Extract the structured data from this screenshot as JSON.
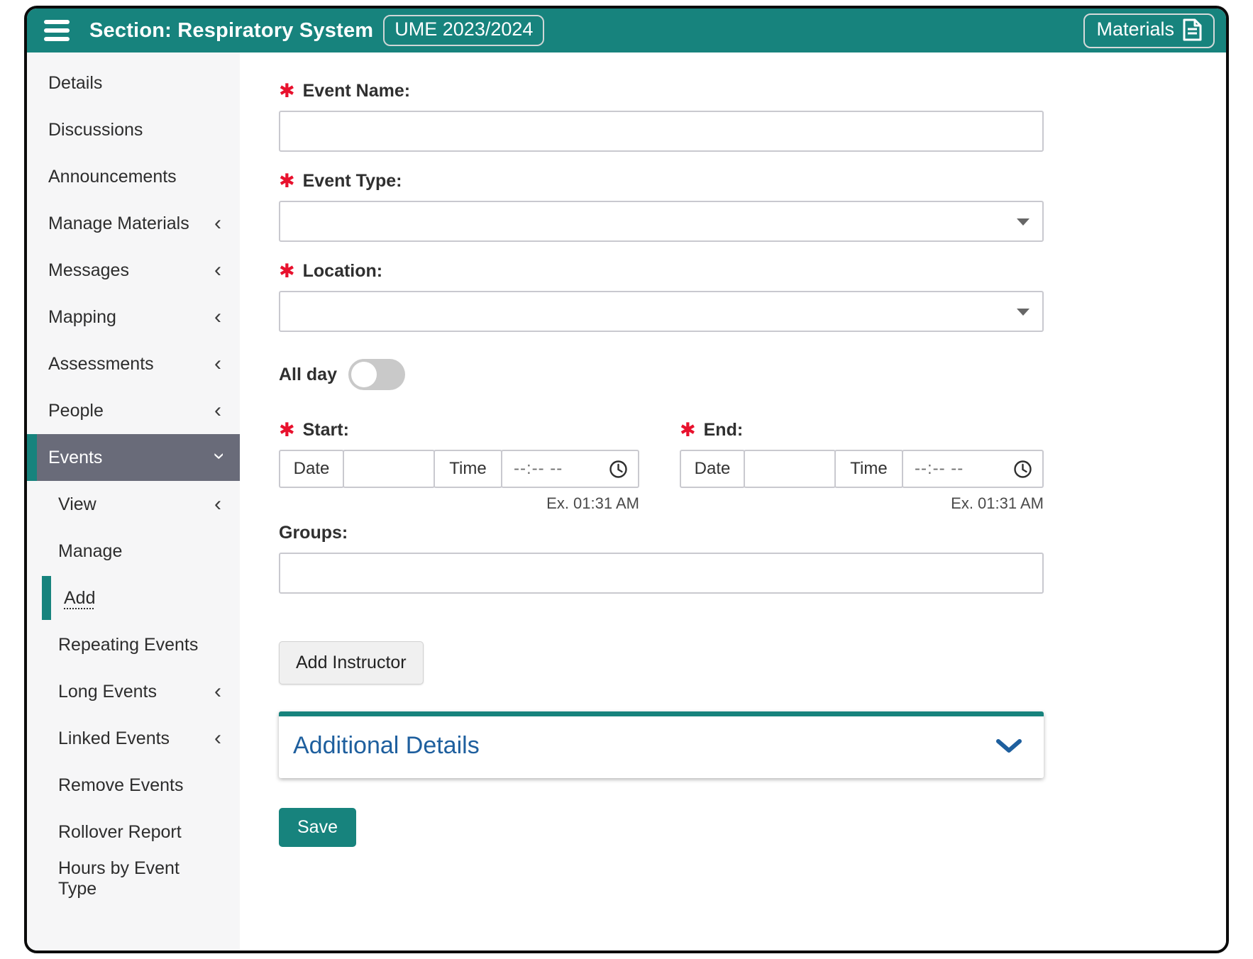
{
  "colors": {
    "teal": "#17837d",
    "selected_gray": "#696b79",
    "link_blue": "#1e5f9e",
    "required_red": "#e8112d"
  },
  "header": {
    "title": "Section: Respiratory System",
    "badge": "UME 2023/2024",
    "materials_label": "Materials"
  },
  "sidebar": {
    "items": [
      {
        "label": "Details",
        "chevron": ""
      },
      {
        "label": "Discussions",
        "chevron": ""
      },
      {
        "label": "Announcements",
        "chevron": ""
      },
      {
        "label": "Manage Materials",
        "chevron": "‹"
      },
      {
        "label": "Messages",
        "chevron": "‹"
      },
      {
        "label": "Mapping",
        "chevron": "‹"
      },
      {
        "label": "Assessments",
        "chevron": "‹"
      },
      {
        "label": "People",
        "chevron": "‹"
      },
      {
        "label": "Events",
        "chevron": "‹",
        "state": "selected-expanded"
      },
      {
        "label": "View",
        "chevron": "‹"
      },
      {
        "label": "Manage",
        "chevron": ""
      },
      {
        "label": "Add",
        "chevron": "",
        "state": "active"
      },
      {
        "label": "Repeating Events",
        "chevron": ""
      },
      {
        "label": "Long Events",
        "chevron": "‹"
      },
      {
        "label": "Linked Events",
        "chevron": "‹"
      },
      {
        "label": "Remove Events",
        "chevron": ""
      },
      {
        "label": "Rollover Report",
        "chevron": ""
      },
      {
        "label": "Hours by Event Type",
        "chevron": ""
      }
    ]
  },
  "form": {
    "required_marker": "✱",
    "event_name": {
      "label": "Event Name:",
      "value": ""
    },
    "event_type": {
      "label": "Event Type:",
      "value": ""
    },
    "location": {
      "label": "Location:",
      "value": ""
    },
    "all_day": {
      "label": "All day",
      "state": "off"
    },
    "start": {
      "label": "Start:",
      "date_addon": "Date",
      "date_value": "",
      "time_addon": "Time",
      "time_placeholder": "--:-- --",
      "hint": "Ex. 01:31 AM"
    },
    "end": {
      "label": "End:",
      "date_addon": "Date",
      "date_value": "",
      "time_addon": "Time",
      "time_placeholder": "--:-- --",
      "hint": "Ex. 01:31 AM"
    },
    "groups": {
      "label": "Groups:",
      "value": ""
    },
    "add_instructor_label": "Add Instructor",
    "additional_details_label": "Additional Details",
    "save_label": "Save"
  }
}
